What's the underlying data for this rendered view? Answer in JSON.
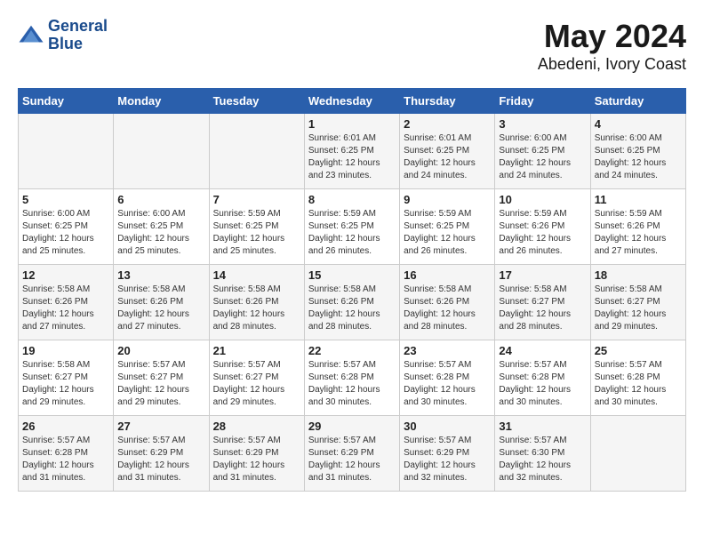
{
  "header": {
    "logo_line1": "General",
    "logo_line2": "Blue",
    "title": "May 2024",
    "subtitle": "Abedeni, Ivory Coast"
  },
  "days_of_week": [
    "Sunday",
    "Monday",
    "Tuesday",
    "Wednesday",
    "Thursday",
    "Friday",
    "Saturday"
  ],
  "weeks": [
    [
      {
        "day": "",
        "info": ""
      },
      {
        "day": "",
        "info": ""
      },
      {
        "day": "",
        "info": ""
      },
      {
        "day": "1",
        "info": "Sunrise: 6:01 AM\nSunset: 6:25 PM\nDaylight: 12 hours\nand 23 minutes."
      },
      {
        "day": "2",
        "info": "Sunrise: 6:01 AM\nSunset: 6:25 PM\nDaylight: 12 hours\nand 24 minutes."
      },
      {
        "day": "3",
        "info": "Sunrise: 6:00 AM\nSunset: 6:25 PM\nDaylight: 12 hours\nand 24 minutes."
      },
      {
        "day": "4",
        "info": "Sunrise: 6:00 AM\nSunset: 6:25 PM\nDaylight: 12 hours\nand 24 minutes."
      }
    ],
    [
      {
        "day": "5",
        "info": "Sunrise: 6:00 AM\nSunset: 6:25 PM\nDaylight: 12 hours\nand 25 minutes."
      },
      {
        "day": "6",
        "info": "Sunrise: 6:00 AM\nSunset: 6:25 PM\nDaylight: 12 hours\nand 25 minutes."
      },
      {
        "day": "7",
        "info": "Sunrise: 5:59 AM\nSunset: 6:25 PM\nDaylight: 12 hours\nand 25 minutes."
      },
      {
        "day": "8",
        "info": "Sunrise: 5:59 AM\nSunset: 6:25 PM\nDaylight: 12 hours\nand 26 minutes."
      },
      {
        "day": "9",
        "info": "Sunrise: 5:59 AM\nSunset: 6:25 PM\nDaylight: 12 hours\nand 26 minutes."
      },
      {
        "day": "10",
        "info": "Sunrise: 5:59 AM\nSunset: 6:26 PM\nDaylight: 12 hours\nand 26 minutes."
      },
      {
        "day": "11",
        "info": "Sunrise: 5:59 AM\nSunset: 6:26 PM\nDaylight: 12 hours\nand 27 minutes."
      }
    ],
    [
      {
        "day": "12",
        "info": "Sunrise: 5:58 AM\nSunset: 6:26 PM\nDaylight: 12 hours\nand 27 minutes."
      },
      {
        "day": "13",
        "info": "Sunrise: 5:58 AM\nSunset: 6:26 PM\nDaylight: 12 hours\nand 27 minutes."
      },
      {
        "day": "14",
        "info": "Sunrise: 5:58 AM\nSunset: 6:26 PM\nDaylight: 12 hours\nand 28 minutes."
      },
      {
        "day": "15",
        "info": "Sunrise: 5:58 AM\nSunset: 6:26 PM\nDaylight: 12 hours\nand 28 minutes."
      },
      {
        "day": "16",
        "info": "Sunrise: 5:58 AM\nSunset: 6:26 PM\nDaylight: 12 hours\nand 28 minutes."
      },
      {
        "day": "17",
        "info": "Sunrise: 5:58 AM\nSunset: 6:27 PM\nDaylight: 12 hours\nand 28 minutes."
      },
      {
        "day": "18",
        "info": "Sunrise: 5:58 AM\nSunset: 6:27 PM\nDaylight: 12 hours\nand 29 minutes."
      }
    ],
    [
      {
        "day": "19",
        "info": "Sunrise: 5:58 AM\nSunset: 6:27 PM\nDaylight: 12 hours\nand 29 minutes."
      },
      {
        "day": "20",
        "info": "Sunrise: 5:57 AM\nSunset: 6:27 PM\nDaylight: 12 hours\nand 29 minutes."
      },
      {
        "day": "21",
        "info": "Sunrise: 5:57 AM\nSunset: 6:27 PM\nDaylight: 12 hours\nand 29 minutes."
      },
      {
        "day": "22",
        "info": "Sunrise: 5:57 AM\nSunset: 6:28 PM\nDaylight: 12 hours\nand 30 minutes."
      },
      {
        "day": "23",
        "info": "Sunrise: 5:57 AM\nSunset: 6:28 PM\nDaylight: 12 hours\nand 30 minutes."
      },
      {
        "day": "24",
        "info": "Sunrise: 5:57 AM\nSunset: 6:28 PM\nDaylight: 12 hours\nand 30 minutes."
      },
      {
        "day": "25",
        "info": "Sunrise: 5:57 AM\nSunset: 6:28 PM\nDaylight: 12 hours\nand 30 minutes."
      }
    ],
    [
      {
        "day": "26",
        "info": "Sunrise: 5:57 AM\nSunset: 6:28 PM\nDaylight: 12 hours\nand 31 minutes."
      },
      {
        "day": "27",
        "info": "Sunrise: 5:57 AM\nSunset: 6:29 PM\nDaylight: 12 hours\nand 31 minutes."
      },
      {
        "day": "28",
        "info": "Sunrise: 5:57 AM\nSunset: 6:29 PM\nDaylight: 12 hours\nand 31 minutes."
      },
      {
        "day": "29",
        "info": "Sunrise: 5:57 AM\nSunset: 6:29 PM\nDaylight: 12 hours\nand 31 minutes."
      },
      {
        "day": "30",
        "info": "Sunrise: 5:57 AM\nSunset: 6:29 PM\nDaylight: 12 hours\nand 32 minutes."
      },
      {
        "day": "31",
        "info": "Sunrise: 5:57 AM\nSunset: 6:30 PM\nDaylight: 12 hours\nand 32 minutes."
      },
      {
        "day": "",
        "info": ""
      }
    ]
  ]
}
